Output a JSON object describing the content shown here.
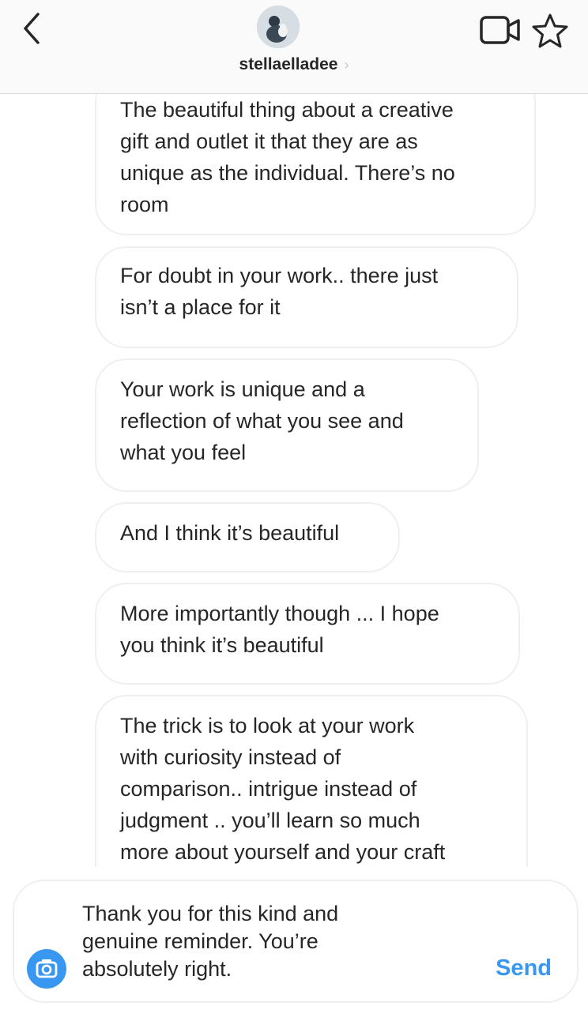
{
  "header": {
    "username": "stellaelladee",
    "chevron": "›",
    "icons": {
      "back": "chevron-left-icon",
      "video": "video-camera-icon",
      "star": "star-icon"
    }
  },
  "messages": [
    {
      "text": "The beautiful thing about a creative\ngift and outlet it that they are as\nunique as the individual. There’s no\nroom"
    },
    {
      "text": "For doubt in your work.. there just\nisn’t a place for it"
    },
    {
      "text": "Your work is unique and a\nreflection of what you see and\nwhat you feel"
    },
    {
      "text": "And I think it’s beautiful"
    },
    {
      "text": "More importantly though ... I hope\nyou think it’s beautiful"
    },
    {
      "text": "The trick is to look at your work\nwith curiosity instead of\ncomparison.. intrigue instead of\njudgment .. you’ll learn so much\nmore about yourself and your craft"
    }
  ],
  "composer": {
    "text": "Thank you for this kind and\ngenuine reminder. You’re\nabsolutely right.",
    "send_label": "Send"
  },
  "colors": {
    "accent": "#3897f0",
    "bubble_border": "#efefef",
    "header_bg": "#fafafa"
  }
}
